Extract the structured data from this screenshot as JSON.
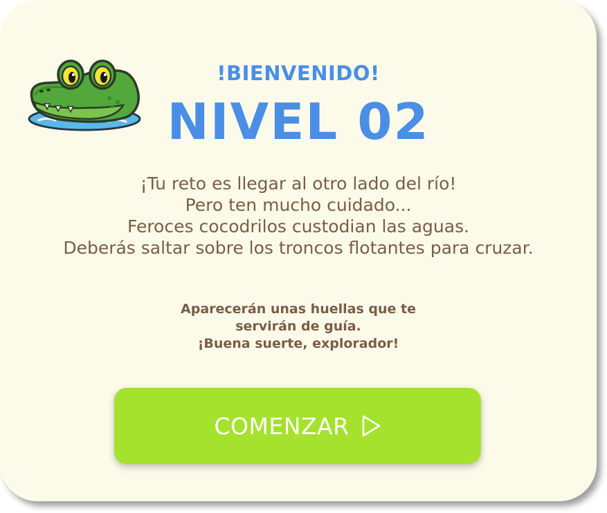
{
  "welcome_title": "!BIENVENIDO!",
  "level_title": "NIVEL 02",
  "story_lines": [
    "¡Tu reto es llegar al otro lado del río!",
    "Pero ten mucho cuidado...",
    "Feroces cocodrilos custodian las aguas.",
    "Deberás saltar sobre los troncos flotantes para cruzar."
  ],
  "hint_lines": [
    "Aparecerán unas huellas que te",
    "servirán de guía.",
    "¡Buena suerte, explorador!"
  ],
  "start_button": {
    "label": "COMENZAR",
    "icon": "play-icon"
  },
  "mascot": {
    "icon": "crocodile-icon"
  },
  "colors": {
    "card_background": "#fcfbea",
    "title": "#4a8ee6",
    "body_text": "#7a5d45",
    "button": "#a4e22d",
    "button_text": "#ffffff"
  }
}
